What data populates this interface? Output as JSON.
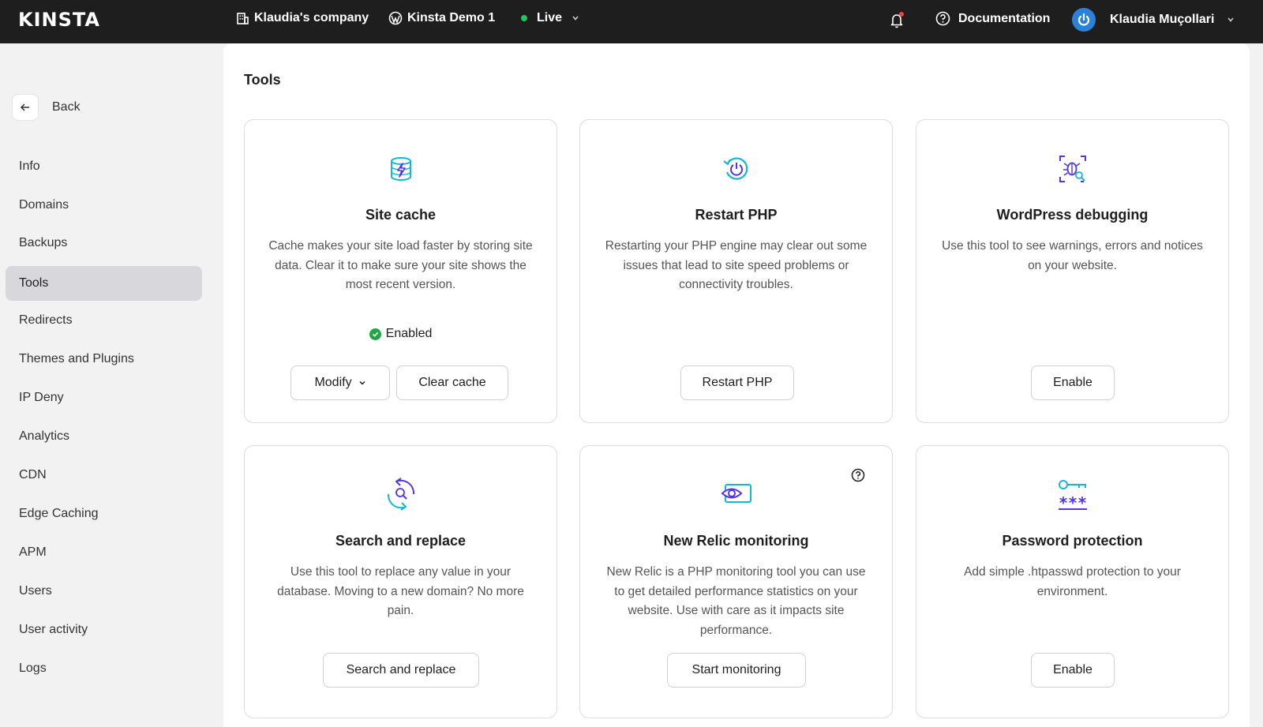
{
  "topbar": {
    "logo": "KINSTA",
    "company": "Klaudia's company",
    "site": "Kinsta Demo 1",
    "environment": "Live",
    "documentation": "Documentation",
    "user_name": "Klaudia Muçollari",
    "live_color": "#22c55e",
    "notification_color": "#ef4444"
  },
  "sidebar": {
    "back_label": "Back",
    "active_item": "Tools",
    "items": [
      {
        "label": "Info"
      },
      {
        "label": "Domains"
      },
      {
        "label": "Backups"
      },
      {
        "label": "Tools"
      },
      {
        "label": "Redirects"
      },
      {
        "label": "Themes and Plugins"
      },
      {
        "label": "IP Deny"
      },
      {
        "label": "Analytics"
      },
      {
        "label": "CDN"
      },
      {
        "label": "Edge Caching"
      },
      {
        "label": "APM"
      },
      {
        "label": "Users"
      },
      {
        "label": "User activity"
      },
      {
        "label": "Logs"
      }
    ]
  },
  "main": {
    "title": "Tools",
    "cards": [
      {
        "icon": "database-lightning-icon",
        "title": "Site cache",
        "description": "Cache makes your site load faster by storing site data. Clear it to make sure your site shows the most recent version.",
        "status": "Enabled",
        "buttons": [
          "Modify",
          "Clear cache"
        ]
      },
      {
        "icon": "power-restart-icon",
        "title": "Restart PHP",
        "description": "Restarting your PHP engine may clear out some issues that lead to site speed problems or connectivity troubles.",
        "buttons": [
          "Restart PHP"
        ]
      },
      {
        "icon": "bug-search-icon",
        "title": "WordPress debugging",
        "description": "Use this tool to see warnings, errors and notices on your website.",
        "buttons": [
          "Enable"
        ]
      },
      {
        "icon": "search-replace-icon",
        "title": "Search and replace",
        "description": "Use this tool to replace any value in your database. Moving to a new domain? No more pain.",
        "buttons": [
          "Search and replace"
        ]
      },
      {
        "icon": "eye-monitor-icon",
        "title": "New Relic monitoring",
        "description": "New Relic is a PHP monitoring tool you can use to get detailed performance statistics on your website. Use with care as it impacts site performance.",
        "buttons": [
          "Start monitoring"
        ]
      },
      {
        "icon": "key-password-icon",
        "title": "Password protection",
        "description": "Add simple .htpasswd protection to your environment.",
        "buttons": [
          "Enable"
        ]
      }
    ]
  },
  "colors": {
    "accent": "#5333ed",
    "accent_secondary": "#14b8d4",
    "enabled": "#22a544"
  }
}
